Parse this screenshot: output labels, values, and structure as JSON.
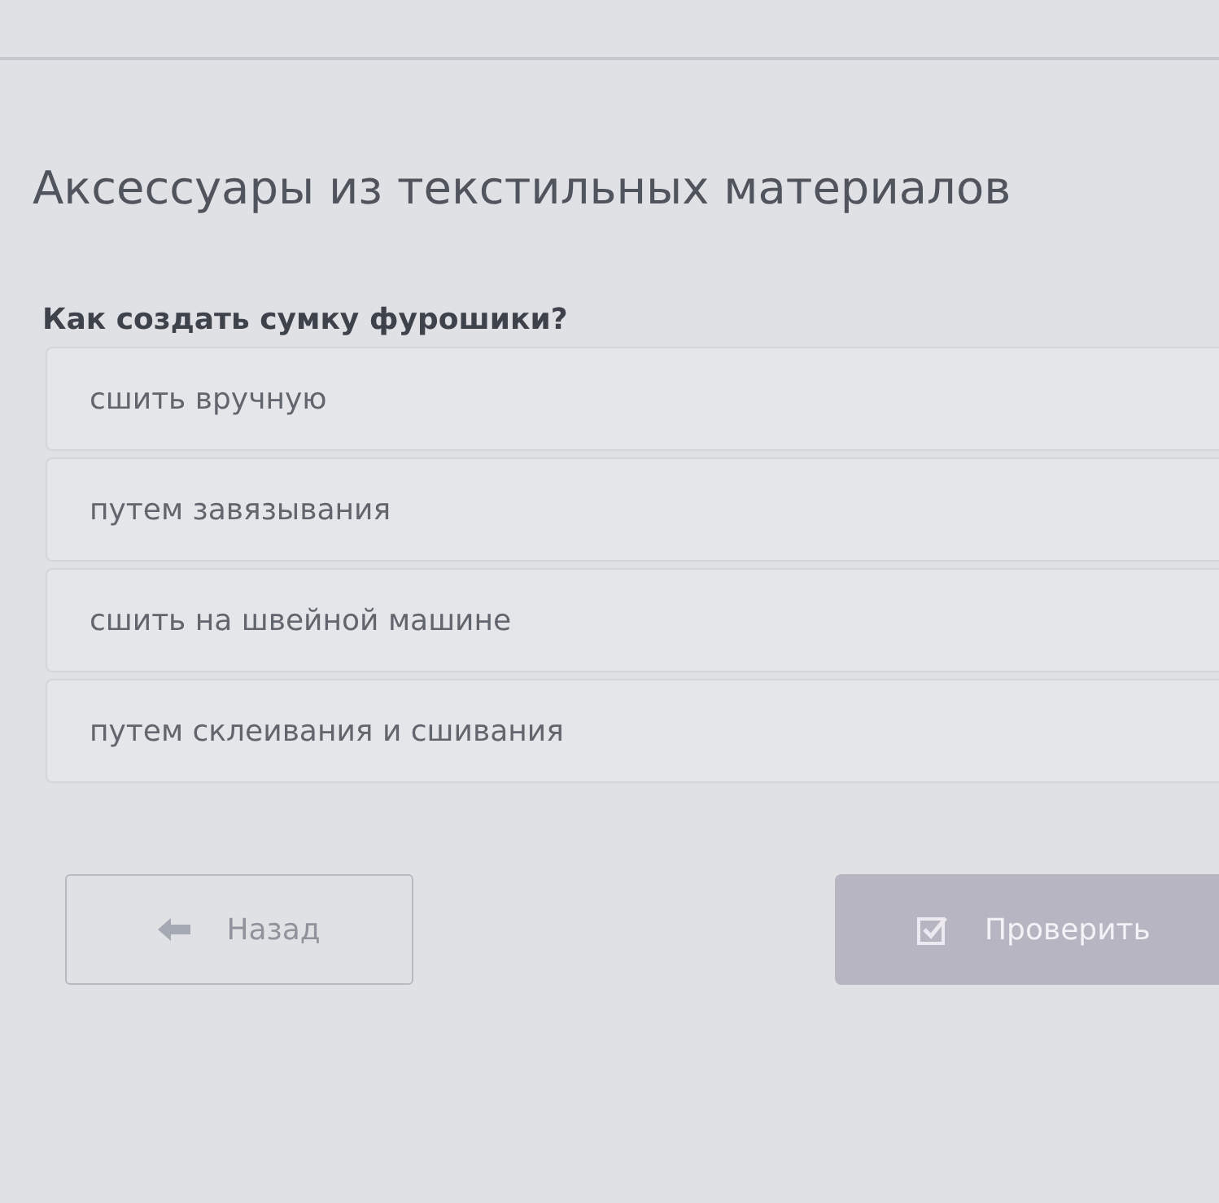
{
  "title": "Аксессуары из текстильных материалов",
  "question": "Как создать сумку фурошики?",
  "options": [
    {
      "label": "сшить вручную",
      "selected": false
    },
    {
      "label": "путем завязывания",
      "selected": false
    },
    {
      "label": "сшить на швейной машине",
      "selected": false
    },
    {
      "label": "путем склеивания и сшивания",
      "selected": false
    }
  ],
  "buttons": [
    {
      "kind": "back",
      "label": "Назад",
      "disabled": false
    },
    {
      "kind": "check",
      "label": "Проверить",
      "disabled": true
    }
  ]
}
